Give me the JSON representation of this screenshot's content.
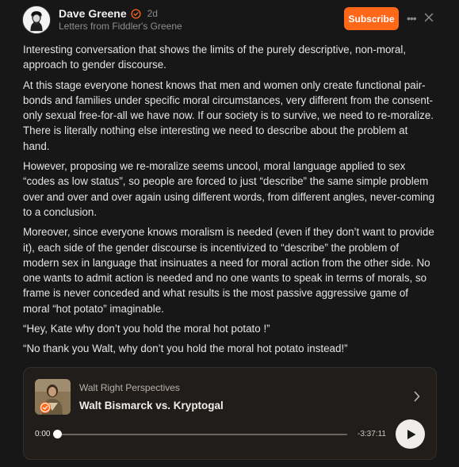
{
  "post": {
    "author": "Dave Greene",
    "time": "2d",
    "publication": "Letters from Fiddler's Greene",
    "subscribe_label": "Subscribe",
    "paragraphs": [
      "Interesting conversation that shows the limits of the purely descriptive, non-moral, approach to gender discourse.",
      "At this stage everyone honest knows that men and women only create functional pair-bonds and families under specific moral circumstances, very different from the consent-only sexual free-for-all we have now. If our society is to survive, we need to re-moralize. There is literally nothing else interesting we need to describe about the problem at hand.",
      "However, proposing we re-moralize seems uncool, moral language applied to sex “codes as low status”, so people are forced to just “describe” the same simple problem over and over and over again using different words, from different angles, never-coming to a conclusion.",
      "Moreover, since everyone knows moralism is needed (even if they don’t want to provide it), each side of the gender discourse is incentivized to “describe” the problem of modern sex in language that insinuates a need for moral action from the other side. No one wants to admit action is needed and no one wants to speak in terms of morals, so frame is never conceded and what results is the most passive aggressive game of moral “hot potato” imaginable.",
      "“Hey, Kate why don’t you hold the moral hot potato !”",
      "“No thank you Walt, why don’t you hold the moral hot potato instead!”"
    ]
  },
  "podcast": {
    "show": "Walt Right Perspectives",
    "title": "Walt Bismarck vs. Kryptogal",
    "elapsed": "0:00",
    "remaining": "-3:37:11",
    "progress": 0
  },
  "icons": {
    "verified": "verified-badge-icon",
    "more": "more-horizontal-icon",
    "close": "close-icon",
    "chevron": "chevron-right-icon",
    "play": "play-icon"
  },
  "colors": {
    "background": "#171717",
    "accent": "#ff6719",
    "card": "#211d1a"
  }
}
